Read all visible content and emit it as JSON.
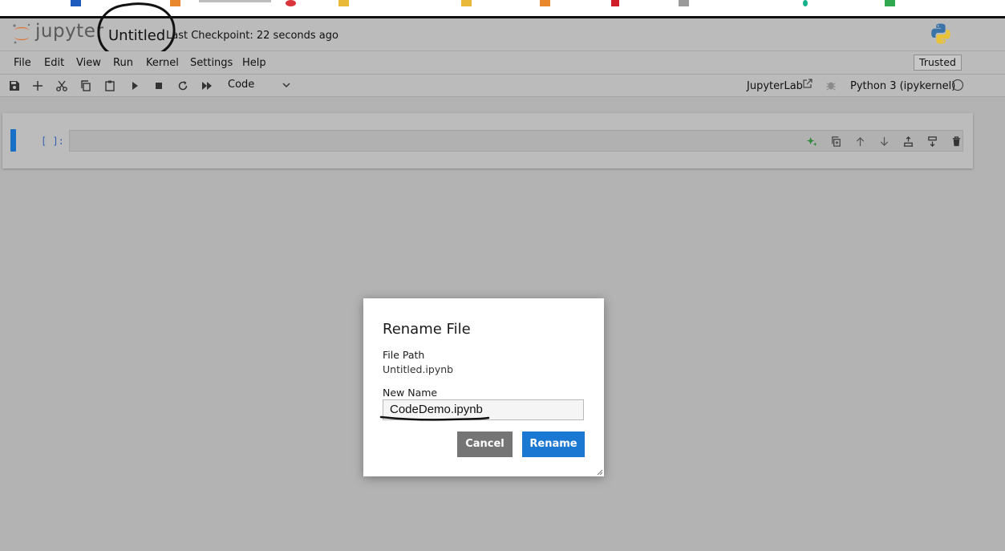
{
  "header": {
    "logo_text": "jupyter",
    "document_title": "Untitled",
    "checkpoint": "Last Checkpoint: 22 seconds ago"
  },
  "menu": {
    "items": [
      "File",
      "Edit",
      "View",
      "Run",
      "Kernel",
      "Settings",
      "Help"
    ],
    "trusted": "Trusted"
  },
  "toolbar": {
    "cell_type": "Code",
    "jupyterlab_link": "JupyterLab",
    "kernel_name": "Python 3 (ipykernel)"
  },
  "cell": {
    "prompt": "[ ]:"
  },
  "dialog": {
    "title": "Rename File",
    "file_path_label": "File Path",
    "file_path_value": "Untitled.ipynb",
    "new_name_label": "New Name",
    "new_name_value": "CodeDemo.ipynb",
    "cancel_label": "Cancel",
    "rename_label": "Rename"
  },
  "colors": {
    "accent": "#1a78d2",
    "cancel": "#757575",
    "collapser": "#1a6fc7",
    "overlay_bg": "#b3b3b3"
  }
}
